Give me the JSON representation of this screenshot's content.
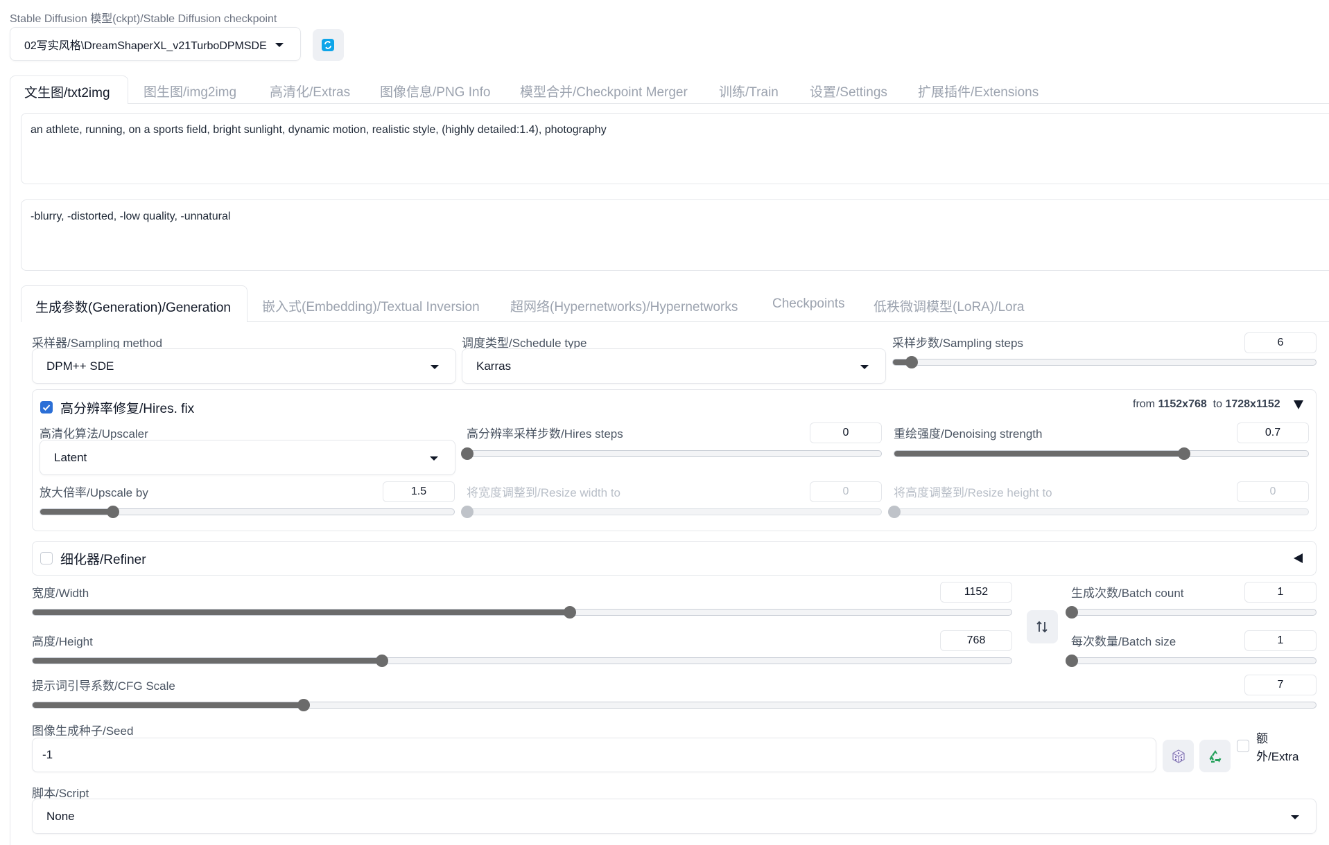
{
  "checkpoint": {
    "label": "Stable Diffusion 模型(ckpt)/Stable Diffusion checkpoint",
    "value": "02写实风格\\DreamShaperXL_v21TurboDPMSDE"
  },
  "main_tabs": [
    {
      "label": "文生图/txt2img"
    },
    {
      "label": "图生图/img2img"
    },
    {
      "label": "高清化/Extras"
    },
    {
      "label": "图像信息/PNG Info"
    },
    {
      "label": "模型合并/Checkpoint Merger"
    },
    {
      "label": "训练/Train"
    },
    {
      "label": "设置/Settings"
    },
    {
      "label": "扩展插件/Extensions"
    }
  ],
  "prompt": "an athlete, running, on a sports field, bright sunlight, dynamic motion, realistic style, (highly detailed:1.4), photography",
  "negative_prompt": "-blurry, -distorted, -low quality, -unnatural",
  "sub_tabs": [
    {
      "label": "生成参数(Generation)/Generation"
    },
    {
      "label": "嵌入式(Embedding)/Textual Inversion"
    },
    {
      "label": "超网络(Hypernetworks)/Hypernetworks"
    },
    {
      "label": "Checkpoints"
    },
    {
      "label": "低秩微调模型(LoRA)/Lora"
    }
  ],
  "sampling_method": {
    "label": "采样器/Sampling method",
    "value": "DPM++ SDE"
  },
  "schedule_type": {
    "label": "调度类型/Schedule type",
    "value": "Karras"
  },
  "sampling_steps": {
    "label": "采样步数/Sampling steps",
    "value": "6",
    "fraction": 0.045
  },
  "hires": {
    "label": "高分辨率修复/Hires. fix",
    "checked": true,
    "from_word": "from",
    "from_size": "1152x768",
    "to_word": "to",
    "to_size": "1728x1152",
    "upscaler": {
      "label": "高清化算法/Upscaler",
      "value": "Latent"
    },
    "hires_steps": {
      "label": "高分辨率采样步数/Hires steps",
      "value": "0",
      "fraction": 0.0
    },
    "denoising": {
      "label": "重绘强度/Denoising strength",
      "value": "0.7",
      "fraction": 0.7
    },
    "upscale_by": {
      "label": "放大倍率/Upscale by",
      "value": "1.5",
      "fraction": 0.176
    },
    "resize_width": {
      "label": "将宽度调整到/Resize width to",
      "value": "0",
      "fraction": 0.0
    },
    "resize_height": {
      "label": "将高度调整到/Resize height to",
      "value": "0",
      "fraction": 0.0
    }
  },
  "refiner": {
    "label": "细化器/Refiner",
    "checked": false
  },
  "width": {
    "label": "宽度/Width",
    "value": "1152",
    "fraction": 0.549
  },
  "height": {
    "label": "高度/Height",
    "value": "768",
    "fraction": 0.357
  },
  "batch_count": {
    "label": "生成次数/Batch count",
    "value": "1",
    "fraction": 0.0
  },
  "batch_size": {
    "label": "每次数量/Batch size",
    "value": "1",
    "fraction": 0.0
  },
  "cfg_scale": {
    "label": "提示词引导系数/CFG Scale",
    "value": "7",
    "fraction": 0.211
  },
  "seed": {
    "label": "图像生成种子/Seed",
    "value": "-1"
  },
  "extra": {
    "label_line1": "额",
    "label_line2": "外/Extra"
  },
  "script": {
    "label": "脚本/Script",
    "value": "None"
  },
  "icons": {
    "refresh": "refresh-icon",
    "swap": "swap-dimensions-icon",
    "dice": "dice-icon",
    "recycle": "recycle-icon"
  },
  "colors": {
    "accent": "#2b6fd6",
    "slider_fill": "#6b6b6b",
    "refresh_icon": "#0ea5e9",
    "recycle_icon": "#22a05a"
  }
}
